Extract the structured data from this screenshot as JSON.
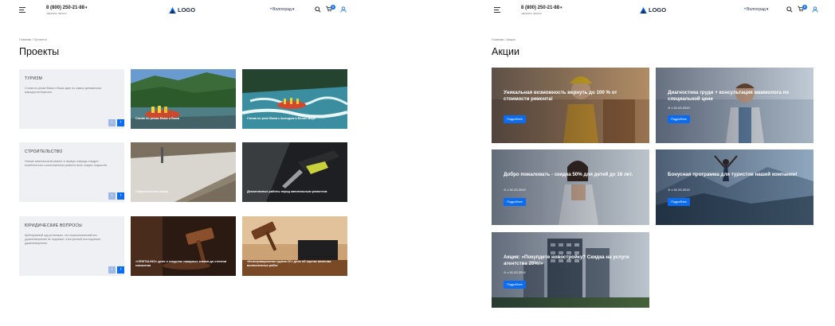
{
  "header": {
    "phone": "8 (800) 250-21-88",
    "callback": "заказать звонок",
    "logo": "LOGO",
    "city": "Волгоград"
  },
  "colors": {
    "accent": "#0a6cf2",
    "category_bg": "#eff0f3"
  },
  "projects": {
    "breadcrumb": "Главная / Проекты",
    "title": "Проекты",
    "categories": [
      {
        "title": "ТУРИЗМ",
        "desc": "Сплав по рекам Вама и Вожа один из самых динамичных маршрутов Карелии."
      },
      {
        "title": "СТРОИТЕЛЬСТВО",
        "desc": "Низкие капитальный ремонт в первую очередь следует позаботиться о качественном ремонте всех старых покрытий."
      },
      {
        "title": "ЮРИДИЧЕСКИЕ ВОПРОСЫ",
        "desc": "Арбитражный суд установил, что первоначальный иск удовлетворению не подлежит, а встречный иск подлежит удовлетворению."
      }
    ],
    "tiles": [
      {
        "caption": "Сплав по рекам Вама и Вожа"
      },
      {
        "caption": "Сплав по реке Вожа с выездом в Белое море"
      },
      {
        "caption": "Строительство позиц"
      },
      {
        "caption": "Демонтажные работы перед капитальным ремонтом"
      },
      {
        "caption": "«CRISTALINO» дело о сходстве товарных знаков до степени смешения"
      },
      {
        "caption": "«Консервационная группа 2С» дело об оценке качества выполненных работ"
      }
    ]
  },
  "promos": {
    "breadcrumb": "Главная / Акции",
    "title": "Акции",
    "button_label": "Подробнее",
    "items": [
      {
        "title": "Уникальная возможность вернуть до 100 % от стоимости ремонта!",
        "date": ""
      },
      {
        "title": "Диагностика груди + консультация маммолога по специальной цене",
        "date": "с 01.03.2019"
      },
      {
        "title": "Добро пожаловать - скидка 50% для детей до 18 лет.",
        "date": "с 01.03.2019"
      },
      {
        "title": "Бонусная программа для туристов нашей компании!",
        "date": "с 01.03.2019"
      },
      {
        "title": "Акция: «Покупдете новостройку? Скидка на услуги агентства 20%!»",
        "date": "с 01.03.2019"
      }
    ]
  }
}
